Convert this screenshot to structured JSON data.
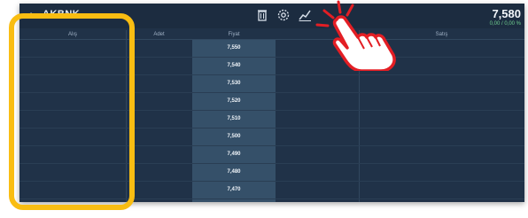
{
  "app": {
    "title": "AKBNK",
    "back_label": "‹"
  },
  "toolbar": {
    "icons": [
      "trash-icon",
      "settings-icon",
      "chart-icon"
    ]
  },
  "quote": {
    "price": "7,580",
    "change": "0,00 / 0,00 %"
  },
  "table": {
    "headers": [
      "Alış",
      "Adet",
      "Fiyat",
      "",
      "Satış"
    ],
    "strikes": [
      "7,550",
      "7,540",
      "7,530",
      "7,520",
      "7,510",
      "7,500",
      "7,490",
      "7,480",
      "7,470"
    ]
  },
  "colors": {
    "background": "#203248",
    "strike_column": "#355069",
    "highlight_outline": "#f9bd12",
    "tap_indicator": "#e31e24"
  },
  "overlay": {
    "tap_icon": "hand-pointer-icon"
  }
}
